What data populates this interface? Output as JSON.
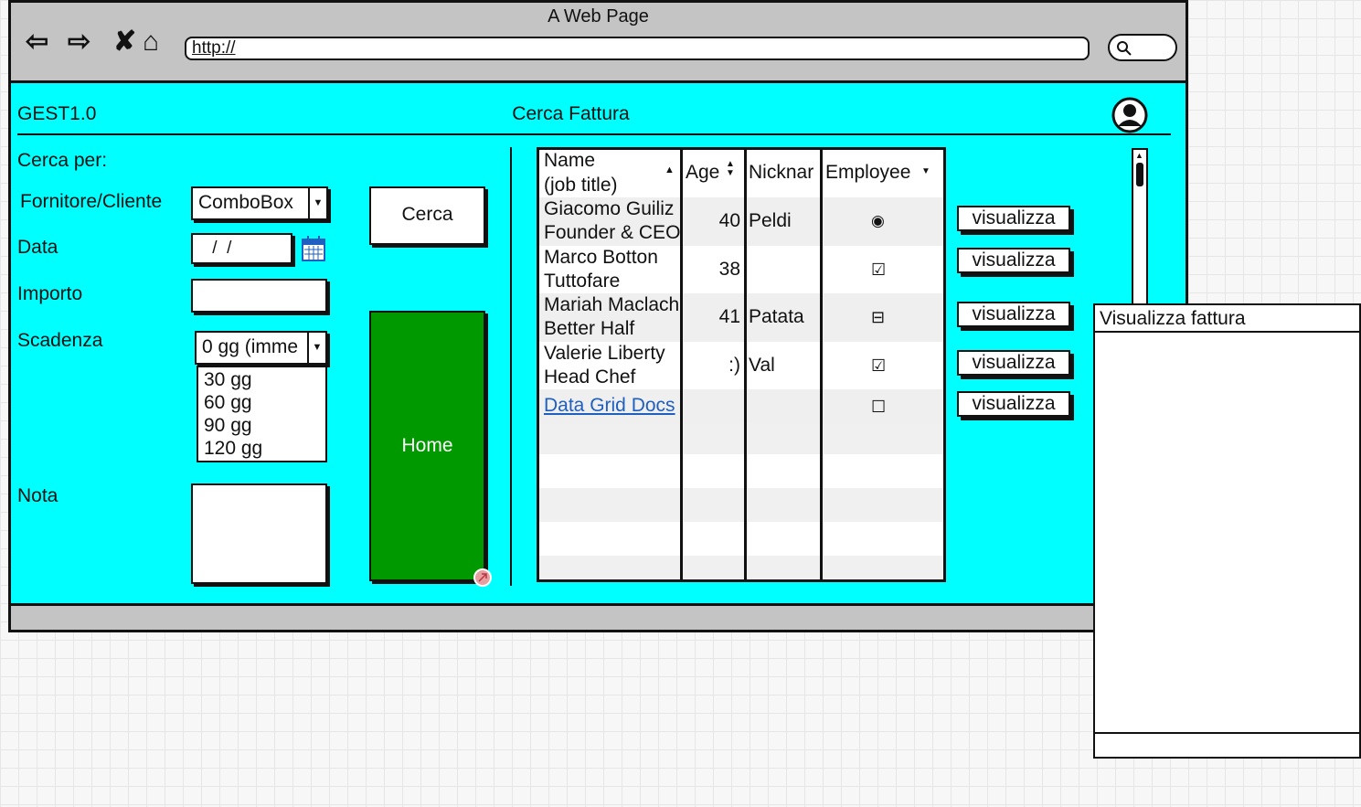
{
  "browser": {
    "title": "A Web Page",
    "url": "http://",
    "nav_icons": [
      "back-arrow-icon",
      "forward-arrow-icon",
      "close-x-icon",
      "home-icon"
    ]
  },
  "app": {
    "name": "GEST1.0",
    "page_title": "Cerca Fattura"
  },
  "form": {
    "search_by": "Cerca per:",
    "fornitore_label": "Fornitore/Cliente",
    "fornitore_value": "ComboBox",
    "data_label": "Data",
    "data_value": " /  /",
    "importo_label": "Importo",
    "scadenza_label": "Scadenza",
    "scadenza_value": "0 gg (imme",
    "scadenza_options": [
      "30 gg",
      "60 gg",
      "90 gg",
      "120 gg"
    ],
    "nota_label": "Nota"
  },
  "buttons": {
    "cerca": "Cerca",
    "home": "Home",
    "visualizza": "visualizza"
  },
  "grid": {
    "headers": {
      "name_line1": "Name",
      "name_line2": "(job title)",
      "age": "Age",
      "nickname": "Nicknar",
      "employee": "Employee"
    },
    "rows": [
      {
        "name": "Giacomo Guiliz",
        "title": "Founder & CEO",
        "age": "40",
        "nickname": "Peldi",
        "employee": "◉"
      },
      {
        "name": "Marco Botton",
        "title": "Tuttofare",
        "age": "38",
        "nickname": "",
        "employee": "☑"
      },
      {
        "name": "Mariah Maclach",
        "title": "Better Half",
        "age": "41",
        "nickname": "Patata",
        "employee": "⊟"
      },
      {
        "name": "Valerie Liberty",
        "title": "Head Chef",
        "age": ":)",
        "nickname": "Val",
        "employee": "☑"
      }
    ],
    "link_row": {
      "name": "Data Grid Docs",
      "employee": "☐"
    }
  },
  "popup": {
    "title": "Visualizza fattura"
  },
  "colors": {
    "content_bg": "#00ffff",
    "home_bg": "#009900",
    "chrome_bg": "#c4c4c4",
    "link": "#1f5fbf"
  }
}
